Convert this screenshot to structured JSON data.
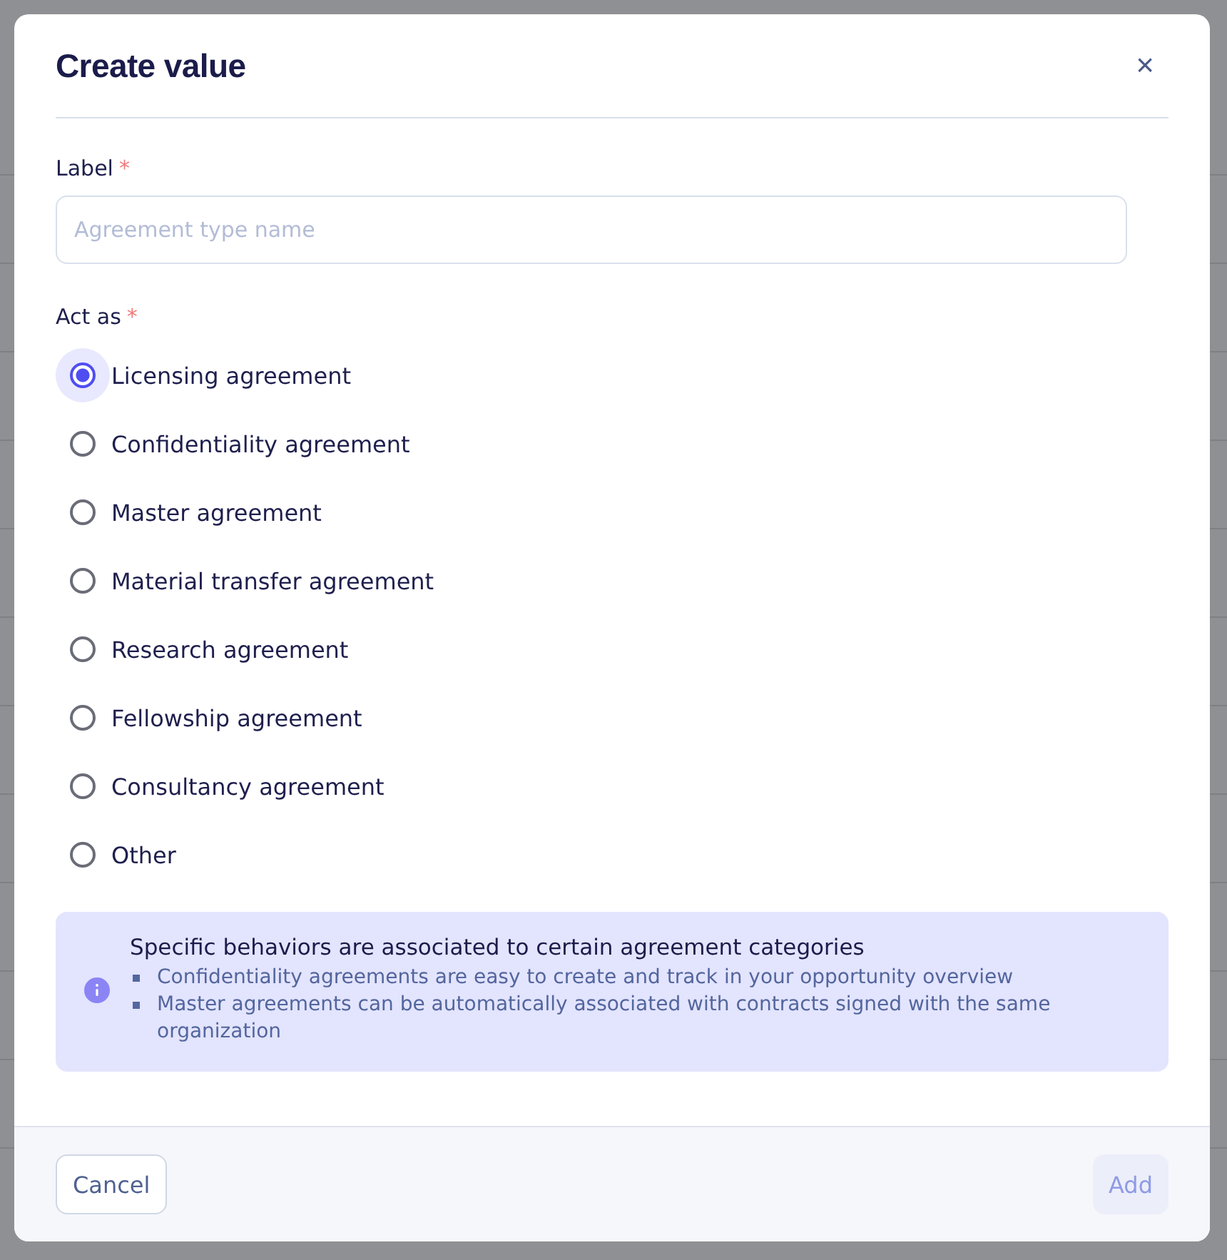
{
  "dialog": {
    "title": "Create value",
    "close": "×"
  },
  "label_field": {
    "label": "Label",
    "required_mark": "*",
    "placeholder": "Agreement type name"
  },
  "act_as": {
    "label": "Act as",
    "required_mark": "*",
    "options": [
      {
        "label": "Licensing agreement",
        "selected": true
      },
      {
        "label": "Confidentiality agreement",
        "selected": false
      },
      {
        "label": "Master agreement",
        "selected": false
      },
      {
        "label": "Material transfer agreement",
        "selected": false
      },
      {
        "label": "Research agreement",
        "selected": false
      },
      {
        "label": "Fellowship agreement",
        "selected": false
      },
      {
        "label": "Consultancy agreement",
        "selected": false
      },
      {
        "label": "Other",
        "selected": false
      }
    ]
  },
  "info": {
    "title": "Specific behaviors are associated to certain agreement categories",
    "items": [
      "Confidentiality agreements are easy to create and track in your opportunity overview",
      "Master agreements can be automatically associated with contracts signed with the same organization"
    ]
  },
  "footer": {
    "cancel": {
      "label": "Cancel"
    },
    "add": {
      "label": "Add",
      "disabled": true
    }
  }
}
